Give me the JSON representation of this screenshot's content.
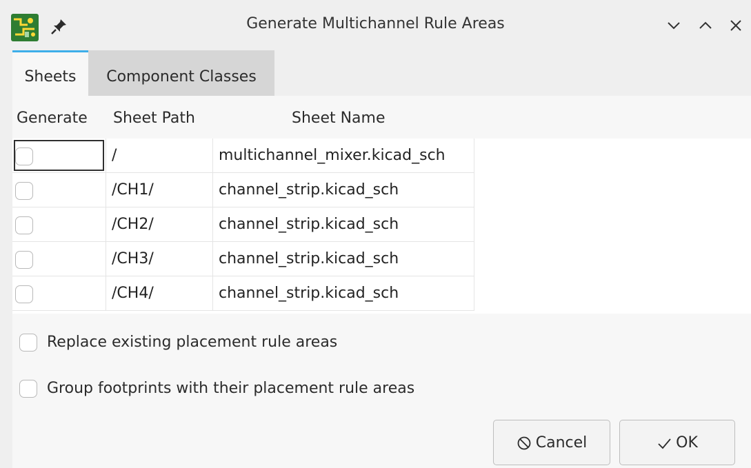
{
  "window": {
    "title": "Generate Multichannel Rule Areas",
    "icons": [
      "kicad-pcb-app-icon",
      "pin-icon",
      "minimize-icon",
      "maximize-icon",
      "close-icon"
    ]
  },
  "tabs": [
    {
      "label": "Sheets",
      "active": true
    },
    {
      "label": "Component Classes",
      "active": false
    }
  ],
  "table": {
    "headers": [
      "Generate",
      "Sheet Path",
      "Sheet Name"
    ],
    "rows": [
      {
        "generate": false,
        "path": "/",
        "name": "multichannel_mixer.kicad_sch"
      },
      {
        "generate": false,
        "path": "/CH1/",
        "name": "channel_strip.kicad_sch"
      },
      {
        "generate": false,
        "path": "/CH2/",
        "name": "channel_strip.kicad_sch"
      },
      {
        "generate": false,
        "path": "/CH3/",
        "name": "channel_strip.kicad_sch"
      },
      {
        "generate": false,
        "path": "/CH4/",
        "name": "channel_strip.kicad_sch"
      }
    ]
  },
  "options": {
    "replace_existing": {
      "label": "Replace existing placement rule areas",
      "checked": false
    },
    "group_footprints": {
      "label": "Group footprints with their placement rule areas",
      "checked": false
    }
  },
  "buttons": {
    "cancel": "Cancel",
    "ok": "OK"
  },
  "colors": {
    "accent": "#3daee9",
    "window_bg": "#efefef",
    "panel_bg": "#f7f7f7",
    "inactive_tab": "#d6d6d6"
  }
}
